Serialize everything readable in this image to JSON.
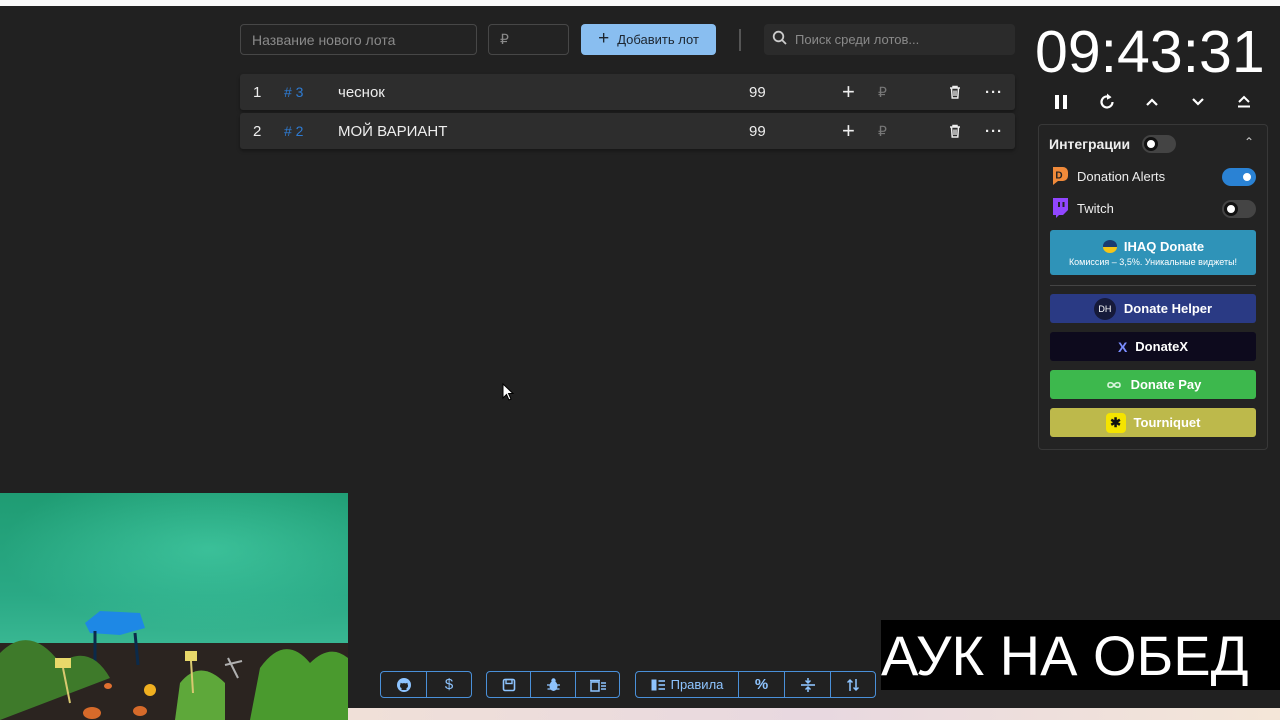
{
  "form": {
    "lot_name_placeholder": "Название нового лота",
    "amount_placeholder": "₽",
    "add_button_label": "Добавить лот",
    "search_placeholder": "Поиск среди лотов..."
  },
  "lots": [
    {
      "index": "1",
      "tag": "# 3",
      "name": "чеснок",
      "amount": "99",
      "currency": "₽"
    },
    {
      "index": "2",
      "tag": "# 2",
      "name": "МОЙ ВАРИАНТ",
      "amount": "99",
      "currency": "₽"
    }
  ],
  "timer": {
    "value": "09:43:31"
  },
  "integrations": {
    "title": "Интеграции",
    "title_toggle_on": false,
    "items": [
      {
        "label": "Donation Alerts",
        "enabled": true,
        "icon": "donation-alerts-icon",
        "color": "#f08a3a"
      },
      {
        "label": "Twitch",
        "enabled": false,
        "icon": "twitch-icon",
        "color": "#9146ff"
      }
    ],
    "sponsors": [
      {
        "label": "IHAQ Donate",
        "sub": "Комиссия – 3,5%. Уникальные виджеты!",
        "color": "#2f93b8"
      },
      {
        "label": "Donate Helper",
        "icon_text": "DH",
        "color": "#2a3a84"
      },
      {
        "label": "DonateX",
        "icon_text": "X",
        "color": "#0d0a1d"
      },
      {
        "label": "Donate Pay",
        "color": "#3db84d"
      },
      {
        "label": "Tourniquet",
        "color": "#bdb94b"
      }
    ]
  },
  "toolbar": {
    "rules_label": "Правила"
  },
  "overlay": {
    "banner_text": "АУК НА ОБЕД"
  },
  "colors": {
    "accent": "#89bef0",
    "background": "#212121",
    "lot_tag": "#2e7bd2",
    "toolbar_border": "#4a90d9"
  }
}
